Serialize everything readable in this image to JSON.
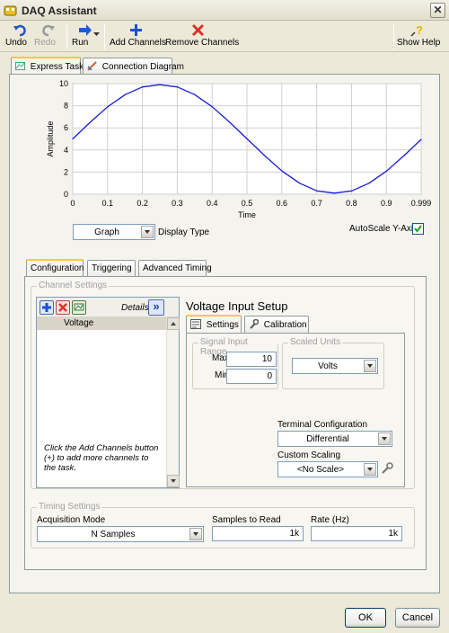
{
  "window": {
    "title": "DAQ Assistant",
    "close_glyph": "✕"
  },
  "toolbar": {
    "undo": "Undo",
    "redo": "Redo",
    "run": "Run",
    "add_channels": "Add Channels",
    "remove_channels": "Remove Channels",
    "show_help": "Show Help"
  },
  "top_tabs": {
    "express_task": "Express Task",
    "connection_diagram": "Connection Diagram"
  },
  "graph": {
    "ylabel": "Amplitude",
    "xlabel": "Time",
    "display_type_value": "Graph",
    "display_type_label": "Display Type",
    "autoscale_label": "AutoScale Y-Axis",
    "autoscale_checked": true
  },
  "chart_data": {
    "type": "line",
    "xlabel": "Time",
    "ylabel": "Amplitude",
    "xlim": [
      0,
      0.999
    ],
    "ylim": [
      0,
      10
    ],
    "x_ticks": [
      "0",
      "0.1",
      "0.2",
      "0.3",
      "0.4",
      "0.5",
      "0.6",
      "0.7",
      "0.8",
      "0.9",
      "0.999"
    ],
    "y_ticks": [
      "0",
      "2",
      "4",
      "6",
      "8",
      "10"
    ],
    "grid": true,
    "series": [
      {
        "color": "#1A1AD6",
        "x": [
          0,
          0.05,
          0.1,
          0.15,
          0.2,
          0.25,
          0.3,
          0.35,
          0.4,
          0.45,
          0.5,
          0.55,
          0.6,
          0.65,
          0.7,
          0.75,
          0.8,
          0.85,
          0.9,
          0.95,
          0.999
        ],
        "y": [
          5.0,
          6.5,
          7.9,
          9.0,
          9.7,
          9.9,
          9.7,
          9.0,
          7.9,
          6.5,
          5.0,
          3.5,
          2.1,
          1.0,
          0.3,
          0.1,
          0.3,
          1.0,
          2.1,
          3.5,
          4.95
        ]
      }
    ]
  },
  "config_tabs": {
    "configuration": "Configuration",
    "triggering": "Triggering",
    "advanced_timing": "Advanced Timing"
  },
  "channel_settings": {
    "legend": "Channel Settings",
    "details_label": "Details",
    "details_glyph": "»",
    "channels": [
      "Voltage"
    ],
    "hint": "Click the Add Channels button (+) to add more channels to the task."
  },
  "voltage_setup": {
    "title": "Voltage Input Setup",
    "tab_settings": "Settings",
    "tab_calibration": "Calibration",
    "signal_range_legend": "Signal Input Range",
    "max_label": "Max",
    "max_value": "10",
    "min_label": "Min",
    "min_value": "0",
    "scaled_units_legend": "Scaled Units",
    "scaled_units_value": "Volts",
    "terminal_config_label": "Terminal Configuration",
    "terminal_config_value": "Differential",
    "custom_scaling_label": "Custom Scaling",
    "custom_scaling_value": "<No Scale>"
  },
  "timing": {
    "legend": "Timing Settings",
    "acq_mode_label": "Acquisition Mode",
    "acq_mode_value": "N Samples",
    "samples_label": "Samples to Read",
    "samples_value": "1k",
    "rate_label": "Rate (Hz)",
    "rate_value": "1k"
  },
  "footer": {
    "ok": "OK",
    "cancel": "Cancel"
  }
}
